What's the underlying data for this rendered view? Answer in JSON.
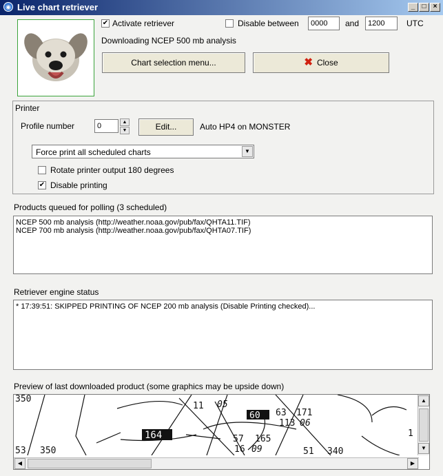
{
  "window": {
    "title": "Live chart retriever",
    "controls": [
      "_",
      "□",
      "×"
    ]
  },
  "header": {
    "activate_label": "Activate retriever",
    "activate_checked": true,
    "disable_between_label": "Disable between",
    "disable_between_checked": false,
    "time_from": "0000",
    "and_label": "and",
    "time_to": "1200",
    "utc_label": "UTC",
    "status_text": "Downloading NCEP 500 mb analysis",
    "chart_menu_button": "Chart selection menu...",
    "close_button": "Close"
  },
  "printer": {
    "group_label": "Printer",
    "profile_label": "Profile number",
    "profile_value": "0",
    "edit_button": "Edit...",
    "printer_name": "Auto HP4 on MONSTER",
    "print_mode_selected": "Force print all scheduled charts",
    "rotate_label": "Rotate printer output 180 degrees",
    "rotate_checked": false,
    "disable_printing_label": "Disable printing",
    "disable_printing_checked": true
  },
  "queue": {
    "label": "Products queued for polling (3 scheduled)",
    "items": [
      "NCEP 500 mb analysis (http://weather.noaa.gov/pub/fax/QHTA11.TIF)",
      "NCEP 700 mb analysis (http://weather.noaa.gov/pub/fax/QHTA07.TIF)"
    ]
  },
  "status": {
    "label": "Retriever engine status",
    "lines": [
      "* 17:39:51: SKIPPED PRINTING OF NCEP 200 mb analysis (Disable Printing checked)..."
    ]
  },
  "preview": {
    "label": "Preview of last downloaded product (some graphics may be upside down)",
    "chart_labels": [
      "350",
      "53",
      "350",
      "11",
      "05",
      "60",
      "63",
      "171",
      "113",
      "06",
      "164",
      "57",
      "165",
      "16",
      "09",
      "51",
      "340",
      "1"
    ]
  }
}
